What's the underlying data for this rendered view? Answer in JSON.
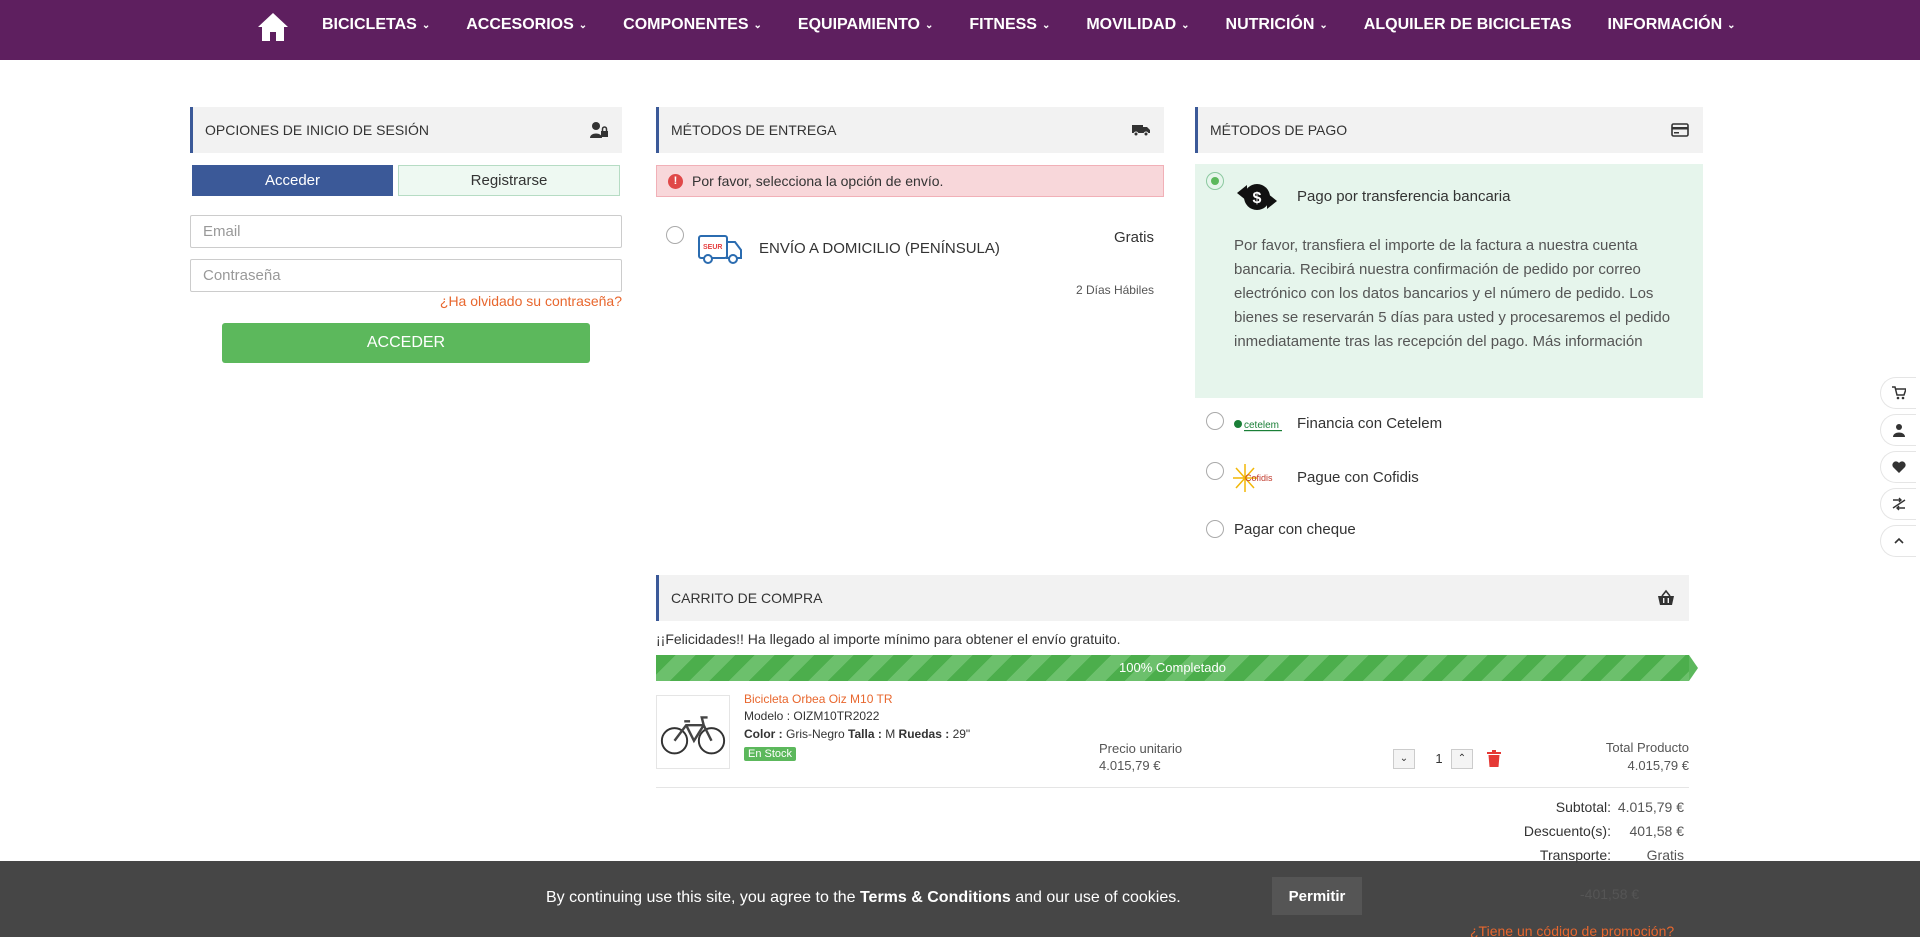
{
  "nav": {
    "items": [
      {
        "label": "BICICLETAS",
        "chevron": true
      },
      {
        "label": "ACCESORIOS",
        "chevron": true
      },
      {
        "label": "COMPONENTES",
        "chevron": true
      },
      {
        "label": "EQUIPAMIENTO",
        "chevron": true
      },
      {
        "label": "FITNESS",
        "chevron": true
      },
      {
        "label": "MOVILIDAD",
        "chevron": true
      },
      {
        "label": "NUTRICIÓN",
        "chevron": true
      },
      {
        "label": "ALQUILER DE BICICLETAS",
        "chevron": false
      },
      {
        "label": "INFORMACIÓN",
        "chevron": true
      }
    ]
  },
  "login": {
    "title": "OPCIONES DE INICIO DE SESIÓN",
    "tab_login": "Acceder",
    "tab_register": "Registrarse",
    "email_placeholder": "Email",
    "password_placeholder": "Contraseña",
    "forgot": "¿Ha olvidado su contraseña?",
    "submit": "ACCEDER"
  },
  "delivery": {
    "title": "MÉTODOS DE ENTREGA",
    "alert": "Por favor, selecciona la opción de envío.",
    "option_name": "ENVÍO A DOMICILIO (PENÍNSULA)",
    "option_price": "Gratis",
    "option_days": "2 Días Hábiles",
    "carrier_logo": "SEUR"
  },
  "payment": {
    "title": "MÉTODOS DE PAGO",
    "options": [
      {
        "label": "Pago por transferencia bancaria"
      },
      {
        "label": "Financia con Cetelem"
      },
      {
        "label": "Pague con Cofidis"
      },
      {
        "label": "Pagar con cheque"
      }
    ],
    "transfer_desc": "Por favor, transfiera el importe de la factura a nuestra cuenta bancaria. Recibirá nuestra confirmación de pedido por correo electrónico con los datos bancarios y el número de pedido. Los bienes se reservarán 5 días para usted y procesaremos el pedido inmediatamente tras las recepción del pago. Más información",
    "cetelem_logo": "cetelem",
    "cofidis_logo": "Cofidis"
  },
  "cart": {
    "title": "CARRITO DE COMPRA",
    "free_shipping_msg": "¡¡Felicidades!! Ha llegado al importe mínimo para obtener el envío gratuito.",
    "progress_pct": 100,
    "progress_text": "100% Completado",
    "product": {
      "name": "Bicicleta Orbea Oiz M10 TR",
      "model_label": "Modelo :",
      "model": "OIZM10TR2022",
      "color_label": "Color :",
      "color": "Gris-Negro",
      "size_label": "Talla :",
      "size": "M",
      "wheels_label": "Ruedas :",
      "wheels": "29\"",
      "stock": "En Stock",
      "unit_price_label": "Precio unitario",
      "unit_price": "4.015,79 €",
      "qty": "1",
      "total_label": "Total Producto",
      "total": "4.015,79 €"
    },
    "summary": {
      "subtotal_label": "Subtotal:",
      "subtotal": "4.015,79 €",
      "discount_label": "Descuento(s):",
      "discount": "401,58 €",
      "shipping_label": "Transporte:",
      "shipping": "Gratis",
      "hidden_value": "-401,58 €",
      "promo_link": "¿Tiene un código de promoción?"
    }
  },
  "cookie": {
    "text_before": "By continuing use this site, you agree to the ",
    "terms": "Terms & Conditions",
    "text_after": " and our use of cookies.",
    "button": "Permitir"
  },
  "side_icons": [
    "cart-icon",
    "user-icon",
    "heart-icon",
    "compare-icon",
    "chevron-up-icon"
  ],
  "colors": {
    "nav_bg": "#5e1f5f",
    "primary_blue": "#3b5998",
    "green": "#5cb85c",
    "link_orange": "#e8672e"
  }
}
